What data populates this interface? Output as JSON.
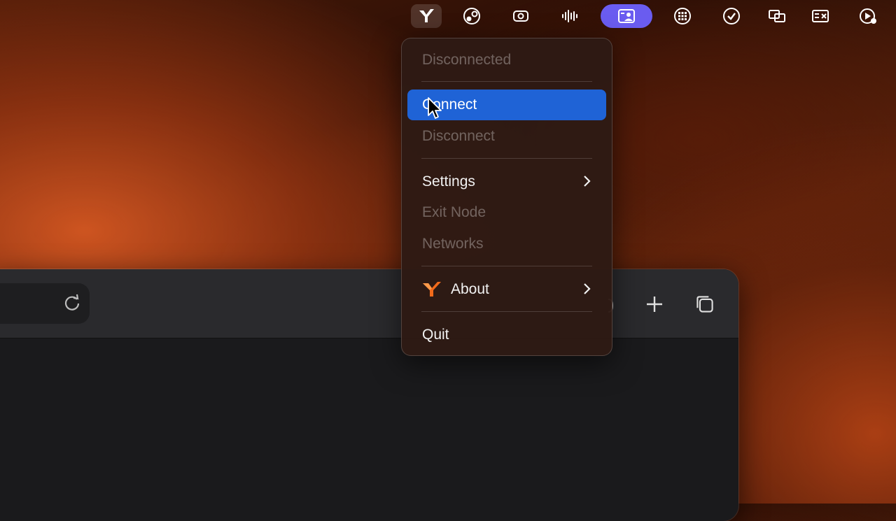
{
  "menubar": {
    "icons": [
      "tailscale-icon",
      "obs-icon",
      "screen-record-icon",
      "audio-waveform-icon",
      "user-profile-icon",
      "grid-icon",
      "checkmark-icon",
      "display-icon",
      "keyboard-icon",
      "timer-icon"
    ]
  },
  "menu": {
    "status": "Disconnected",
    "connect": "Connect",
    "disconnect": "Disconnect",
    "settings": "Settings",
    "exit_node": "Exit Node",
    "networks": "Networks",
    "about": "About",
    "quit": "Quit"
  },
  "colors": {
    "highlight": "#1f63d6",
    "accent_purple": "#6a5cf0",
    "logo_orange": "#f26a1b"
  }
}
